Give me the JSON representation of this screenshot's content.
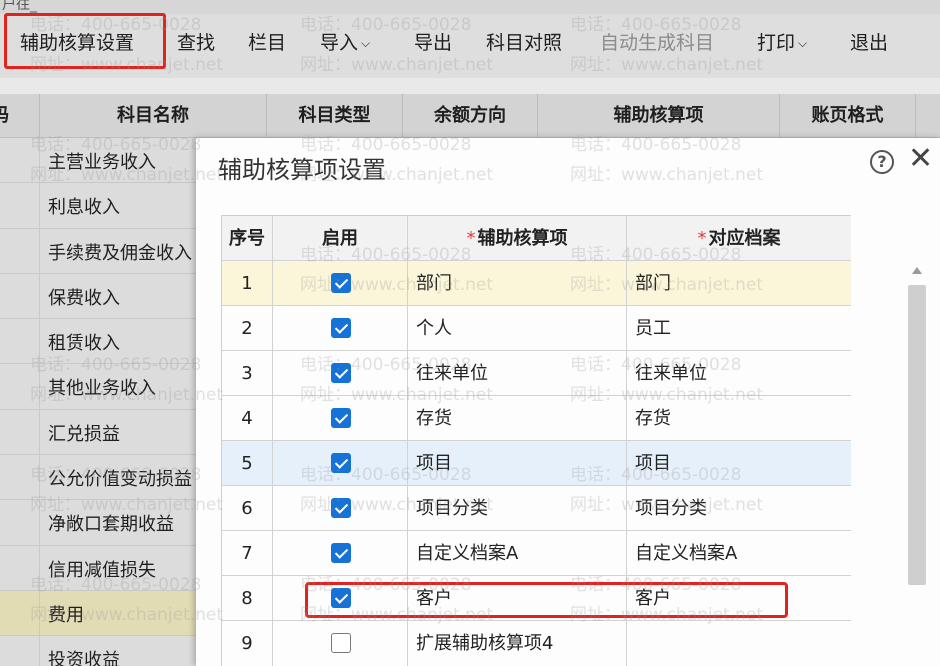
{
  "window": {
    "title_fragment": "户往_"
  },
  "toolbar": {
    "items": [
      {
        "label": "辅助核算设置",
        "disabled": false,
        "dropdown": false,
        "highlighted": true
      },
      {
        "label": "查找",
        "disabled": false,
        "dropdown": false
      },
      {
        "label": "栏目",
        "disabled": false,
        "dropdown": false
      },
      {
        "label": "导入",
        "disabled": false,
        "dropdown": true
      },
      {
        "label": "导出",
        "disabled": false,
        "dropdown": false
      },
      {
        "label": "科目对照",
        "disabled": false,
        "dropdown": false
      },
      {
        "label": "自动生成科目",
        "disabled": true,
        "dropdown": false
      },
      {
        "label": "打印",
        "disabled": false,
        "dropdown": true
      },
      {
        "label": "退出",
        "disabled": false,
        "dropdown": false
      }
    ]
  },
  "grid": {
    "headers": [
      "码",
      "科目名称",
      "科目类型",
      "余额方向",
      "辅助核算项",
      "账页格式"
    ],
    "rows": [
      "主营业务收入",
      "利息收入",
      "手续费及佣金收入",
      "保费收入",
      "租赁收入",
      "其他业务收入",
      "汇兑损益",
      "公允价值变动损益",
      "净敞口套期收益",
      "信用减值损失",
      "费用",
      "投资收益"
    ],
    "selected_row": "费用"
  },
  "dialog": {
    "title": "辅助核算项设置",
    "help_icon": "question-circle-icon",
    "close_icon": "close-icon",
    "table": {
      "headers": {
        "index": "序号",
        "enabled": "启用",
        "item": "辅助核算项",
        "archive": "对应档案",
        "required_mark": "*"
      },
      "rows": [
        {
          "index": "1",
          "enabled": true,
          "item": "部门",
          "archive": "部门"
        },
        {
          "index": "2",
          "enabled": true,
          "item": "个人",
          "archive": "员工"
        },
        {
          "index": "3",
          "enabled": true,
          "item": "往来单位",
          "archive": "往来单位"
        },
        {
          "index": "4",
          "enabled": true,
          "item": "存货",
          "archive": "存货"
        },
        {
          "index": "5",
          "enabled": true,
          "item": "项目",
          "archive": "项目"
        },
        {
          "index": "6",
          "enabled": true,
          "item": "项目分类",
          "archive": "项目分类"
        },
        {
          "index": "7",
          "enabled": true,
          "item": "自定义档案A",
          "archive": "自定义档案A"
        },
        {
          "index": "8",
          "enabled": true,
          "item": "客户",
          "archive": "客户",
          "highlighted": true
        },
        {
          "index": "9",
          "enabled": false,
          "item": "扩展辅助核算项4",
          "archive": ""
        }
      ]
    }
  },
  "colors": {
    "accent": "#1672d6",
    "highlight_box": "#e0231e",
    "selected_row": "#fbf6da",
    "hover_row": "#e6f0fb"
  },
  "watermark": {
    "phone": "电话：400-665-0028",
    "site": "网址：www.chanjet.net"
  }
}
